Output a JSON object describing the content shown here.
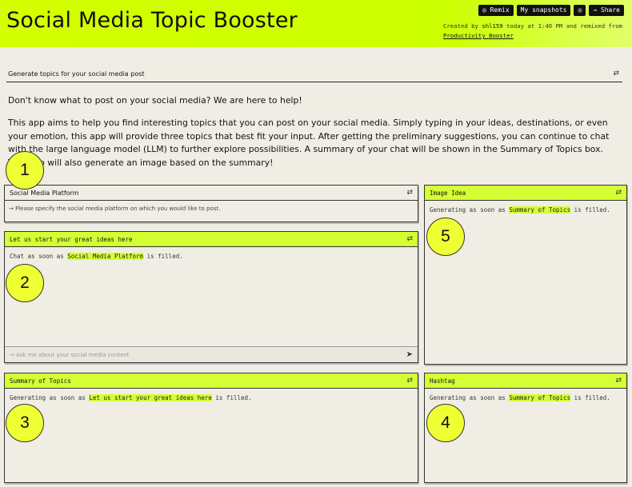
{
  "header": {
    "title": "Social Media Topic Booster",
    "buttons": {
      "remix": "◎ Remix",
      "snapshots": "My snapshots",
      "camera": "◎",
      "share": "→ Share"
    },
    "credit_prefix": "Created by ",
    "credit_user": "shl159",
    "credit_mid": " today at 1:40 PM and remixed from ",
    "credit_link": "Productivity Booster"
  },
  "section": {
    "label": "Generate topics for your social media post"
  },
  "description": {
    "line1": "Don't know what to post on your social media? We are here to help!",
    "line2": "This app aims to help you find interesting topics that you can post on your social media. Simply typing in your ideas, destinations, or even your emotion, this app will provide three topics that best fit your input. After getting the preliminary suggestions, you can continue to chat with the large language model (LLM) to further explore possibilities. A summary of your chat will be shown in the Summary of Topics box. This app will also generate an image based on the summary!"
  },
  "panels": {
    "platform": {
      "title": "Social Media Platform",
      "placeholder": "→ Please specify the social media platform on which you would like to post."
    },
    "chat": {
      "title": "Let us start your great ideas here",
      "body_prefix": "Chat as soon as ",
      "body_ref": "Social Media Platform",
      "body_suffix": " is filled.",
      "input_placeholder": "→ Ask me about your social media content"
    },
    "image": {
      "title": "Image Idea",
      "body_prefix": "Generating as soon as ",
      "body_ref": "Summary of Topics",
      "body_suffix": " is filled."
    },
    "summary": {
      "title": "Summary of Topics",
      "body_prefix": "Generating as soon as ",
      "body_ref": "Let us start your great ideas here",
      "body_suffix": " is filled."
    },
    "hashtag": {
      "title": "Hashtag",
      "body_prefix": "Generating as soon as ",
      "body_ref": "Summary of Topics",
      "body_suffix": " is filled."
    }
  },
  "markers": [
    "1",
    "2",
    "3",
    "4",
    "5"
  ],
  "colors": {
    "accent": "#d4ff33",
    "background": "#f0eee4",
    "marker": "#eeff33"
  },
  "icons": {
    "settings": "sliders-icon",
    "send": "send-icon"
  }
}
